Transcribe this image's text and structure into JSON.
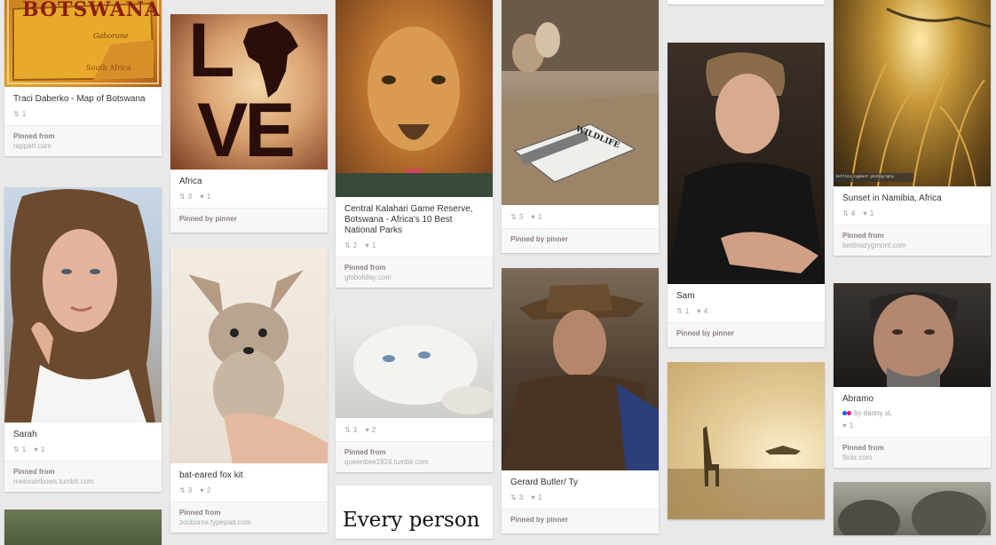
{
  "pins": [
    {
      "description": "Traci Daberko - Map of Botswana",
      "repins": "1",
      "likes": "",
      "pinned_label": "Pinned from",
      "source": "rappart.com",
      "image_text": {
        "title": "BOTSWANA",
        "city": "Gaborone",
        "region": "South Africa"
      }
    },
    {
      "description": "Sarah",
      "repins": "1",
      "likes": "1",
      "pinned_label": "Pinned from",
      "source": "meinrainbows.tumblr.com"
    },
    {
      "description": "Africa",
      "repins": "3",
      "likes": "1",
      "pinned_label": "Pinned by pinner",
      "source": "",
      "image_text": {
        "l": "L",
        "ve": "VE"
      }
    },
    {
      "description": "bat-eared fox kit",
      "repins": "3",
      "likes": "2",
      "pinned_label": "Pinned from",
      "source": "zooborns.typepad.com"
    },
    {
      "description": "Central Kalahari Game Reserve, Botswana - Africa's 10 Best National Parks",
      "repins": "2",
      "likes": "1",
      "pinned_label": "Pinned from",
      "source": "globoliday.com"
    },
    {
      "description": "",
      "repins": "3",
      "likes": "2",
      "pinned_label": "Pinned from",
      "source": "queenbee1924.tumblr.com"
    },
    {
      "description": "Every person",
      "image_only": true
    },
    {
      "description": "",
      "repins": "3",
      "likes": "1",
      "pinned_label": "Pinned by pinner",
      "source": "",
      "image_text": {
        "magazine": "WILDLIFE"
      }
    },
    {
      "description": "Gerard Butler/ Ty",
      "repins": "3",
      "likes": "1",
      "pinned_label": "Pinned by pinner",
      "source": ""
    },
    {
      "description": "Sam",
      "repins": "1",
      "likes": "4",
      "pinned_label": "Pinned by pinner",
      "source": ""
    },
    {
      "description": "Sunset in Namibia, Africa",
      "repins": "4",
      "likes": "1",
      "pinned_label": "Pinned from",
      "source": "bettinazygmont.com",
      "image_text": {
        "credit": "bettina zygmont photography"
      }
    },
    {
      "description": "Abramo",
      "via": "by danny st.",
      "repins": "",
      "likes": "1",
      "pinned_label": "Pinned from",
      "source": "flickr.com"
    }
  ],
  "icons": {
    "repin": "repin-icon",
    "like": "heart-icon",
    "flickr": "flickr-icon"
  },
  "colors": {
    "background": "#e9e9e9",
    "card": "#ffffff",
    "footer": "#f7f7f7",
    "pinned_label": "#8c7e7e"
  }
}
